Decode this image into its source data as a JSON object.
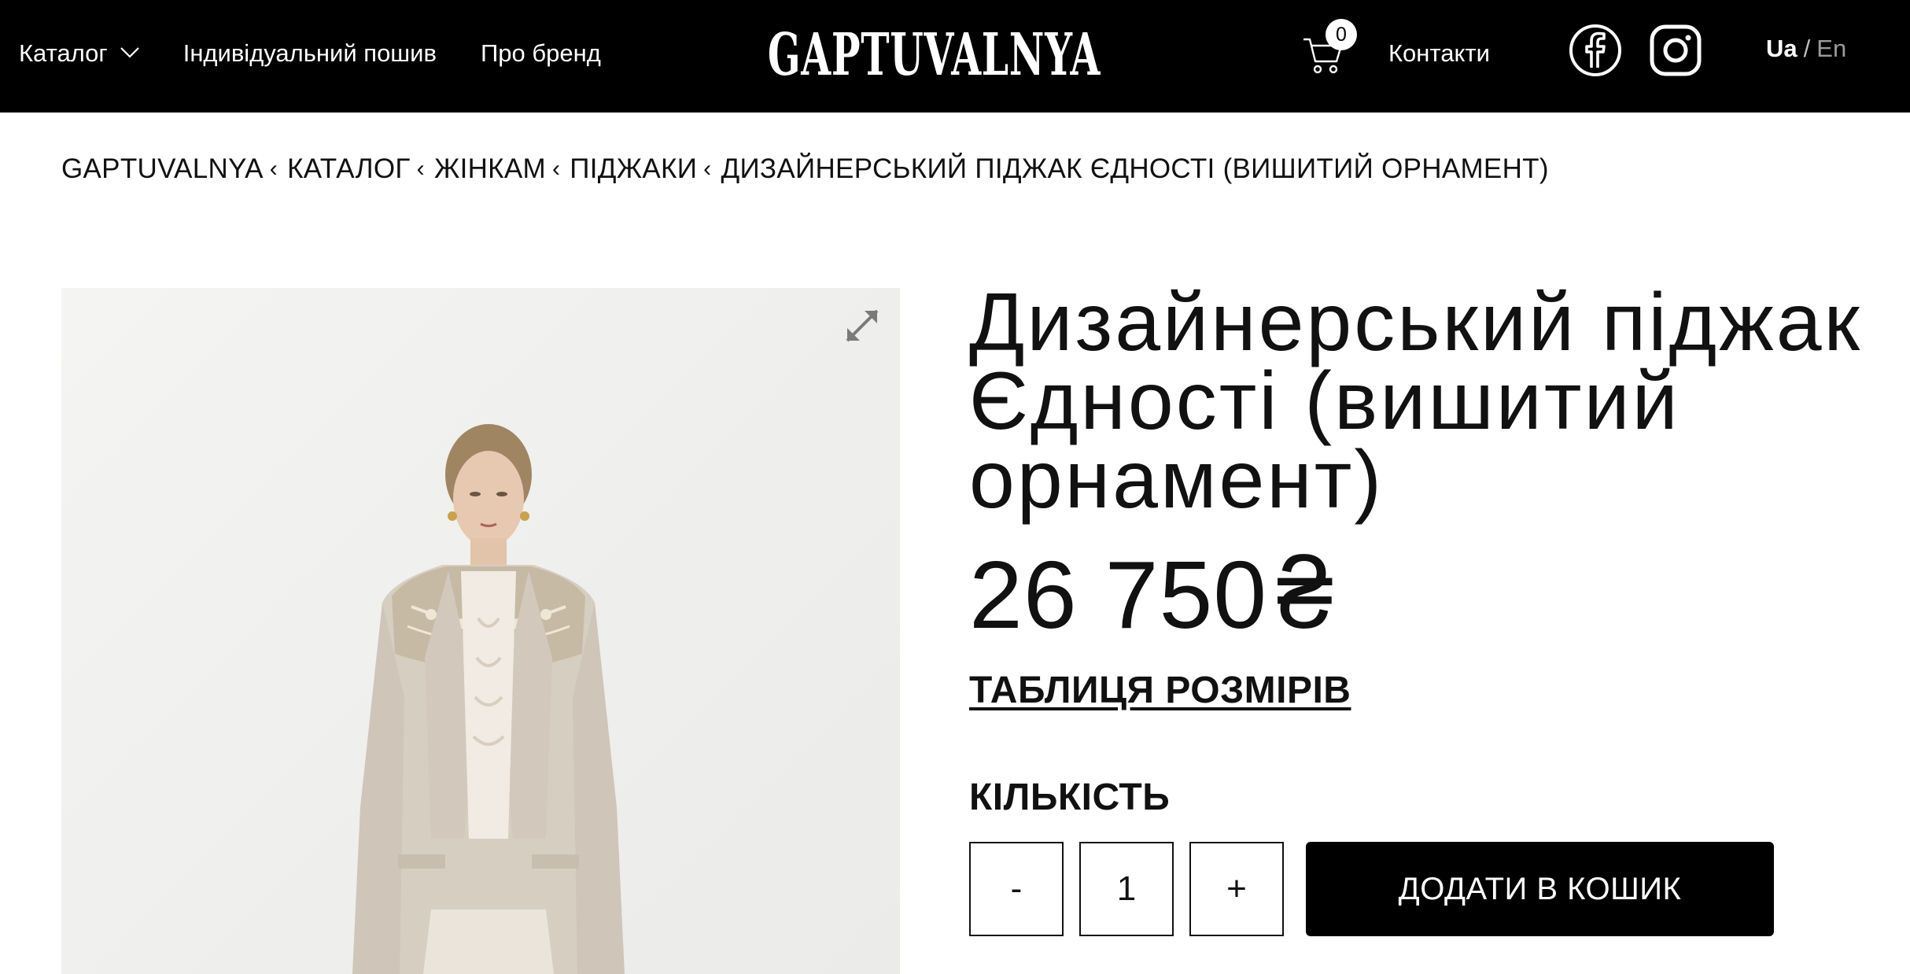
{
  "header": {
    "nav": {
      "catalog_label": "Каталог",
      "custom_tailoring_label": "Індивідуальний пошив",
      "about_brand_label": "Про бренд"
    },
    "logo_text": "GAPTUVALNYA",
    "cart": {
      "count": "0",
      "icon": "cart-icon"
    },
    "contacts_label": "Контакти",
    "social": {
      "facebook_icon": "facebook-icon",
      "instagram_icon": "instagram-icon"
    },
    "language": {
      "active": "Ua",
      "separator": "/",
      "inactive": "En"
    }
  },
  "breadcrumb": {
    "items": [
      "GAPTUVALNYA",
      "КАТАЛОГ",
      "ЖІНКАМ",
      "ПІДЖАКИ",
      "ДИЗАЙНЕРСЬКИЙ ПІДЖАК ЄДНОСТІ (ВИШИТИЙ ОРНАМЕНТ)"
    ],
    "separator": "‹"
  },
  "product": {
    "title": "Дизайнерський піджак Єдності (вишитий орнамент)",
    "price": "26 750",
    "currency": "₴",
    "size_table_label": "ТАБЛИЦЯ РОЗМІРІВ",
    "quantity_label": "КІЛЬКІСТЬ",
    "quantity": {
      "decrement_label": "-",
      "value": "1",
      "increment_label": "+"
    },
    "add_to_cart_label": "ДОДАТИ В КОШИК",
    "image": {
      "description_icon": "expand-icon"
    }
  },
  "colors": {
    "header_bg": "#000000",
    "header_text": "#ffffff",
    "text": "#111111",
    "button_bg": "#000000",
    "image_bg": "#eeeeec"
  }
}
